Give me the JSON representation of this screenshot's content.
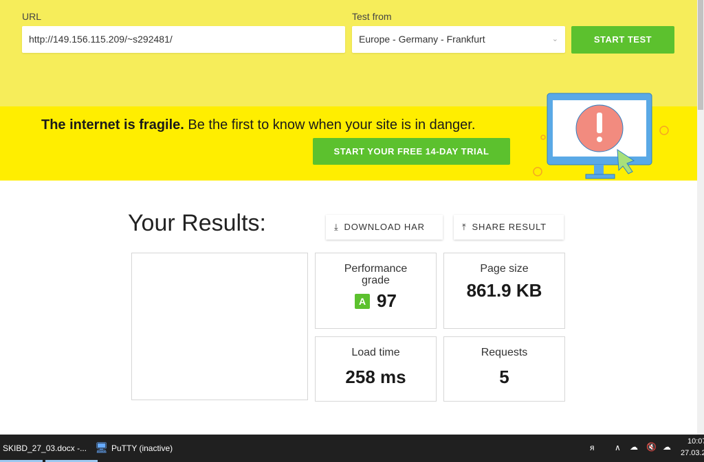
{
  "form": {
    "url_label": "URL",
    "url_value": "http://149.156.115.209/~s292481/",
    "test_from_label": "Test from",
    "test_from_value": "Europe - Germany - Frankfurt",
    "start_test": "START TEST"
  },
  "banner": {
    "bold": "The internet is fragile.",
    "text": " Be the first to know when your site is in danger.",
    "cta": "START YOUR FREE 14-DAY TRIAL"
  },
  "results": {
    "title": "Your Results:",
    "download_har": "DOWNLOAD HAR",
    "share_result": "SHARE RESULT",
    "performance_label": "Performance grade",
    "grade_letter": "A",
    "grade_value": "97",
    "grade_color": "#5cc12e",
    "page_size_label": "Page size",
    "page_size_value": "861.9 KB",
    "load_time_label": "Load time",
    "load_time_value": "258 ms",
    "requests_label": "Requests",
    "requests_value": "5"
  },
  "taskbar": {
    "items": [
      "SKIBD_27_03.docx -...",
      "PuTTY (inactive)"
    ],
    "time": "10:07",
    "date": "27.03.2"
  }
}
